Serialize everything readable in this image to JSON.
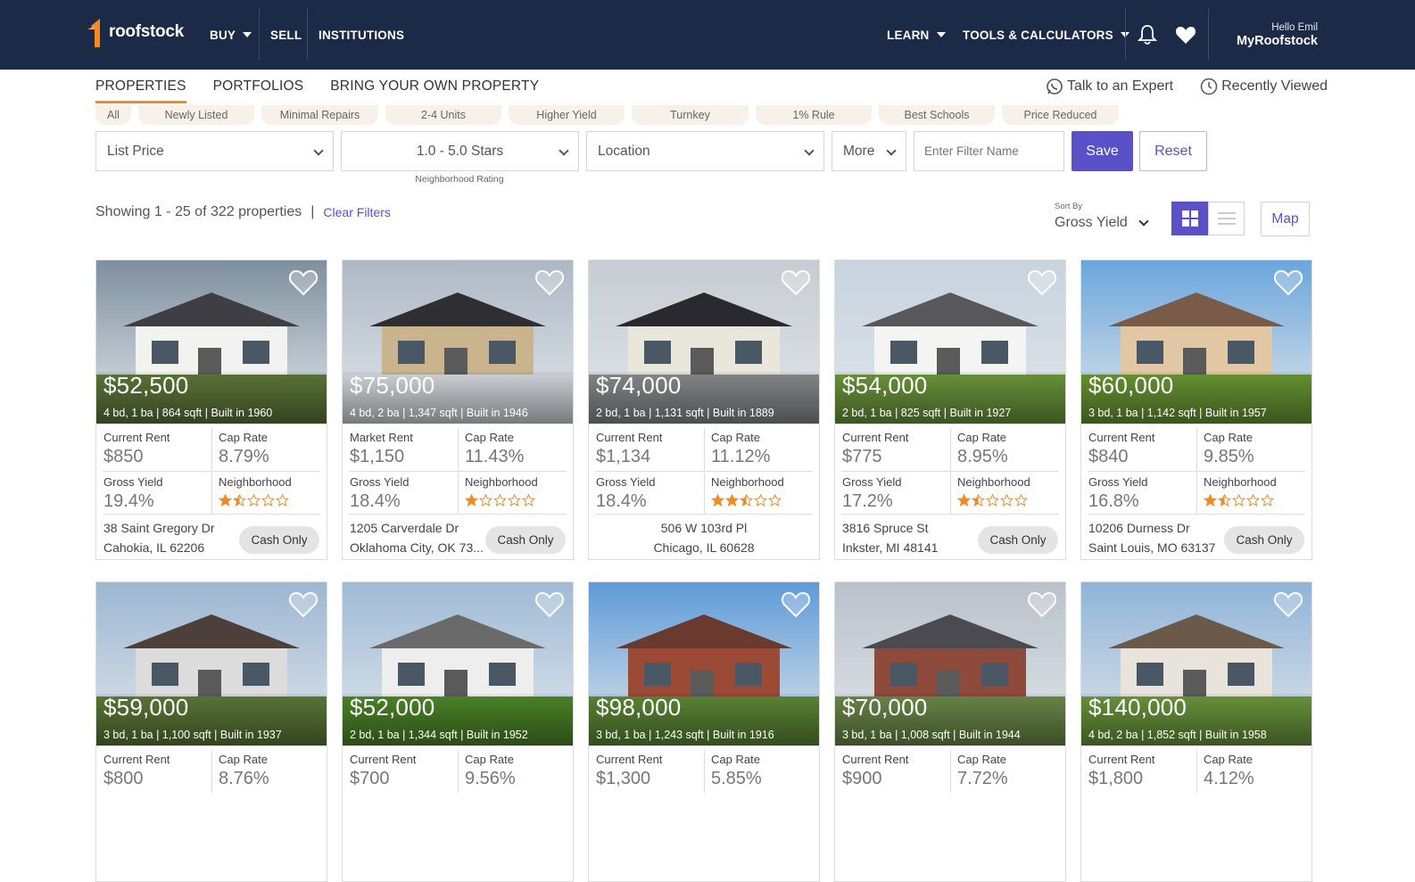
{
  "nav": {
    "logo_text": "roofstock",
    "buy": "BUY",
    "sell": "SELL",
    "institutions": "INSTITUTIONS",
    "learn": "LEARN",
    "tools": "TOOLS & CALCULATORS",
    "hello": "Hello Emil",
    "account": "MyRoofstock"
  },
  "tabs": {
    "properties": "PROPERTIES",
    "portfolios": "PORTFOLIOS",
    "byop": "BRING YOUR OWN PROPERTY",
    "talk": "Talk to an Expert",
    "recent": "Recently Viewed"
  },
  "chips": [
    "All",
    "Newly Listed",
    "Minimal Repairs",
    "2-4 Units",
    "Higher Yield",
    "Turnkey",
    "1% Rule",
    "Best Schools",
    "Price Reduced"
  ],
  "filters": {
    "price": "List Price",
    "stars": "1.0 - 5.0 Stars",
    "stars_caption": "Neighborhood Rating",
    "location": "Location",
    "more": "More",
    "name_placeholder": "Enter Filter Name",
    "save": "Save",
    "reset": "Reset"
  },
  "results": {
    "showing": "Showing 1 - 25 of 322 properties",
    "pipe": "|",
    "clear": "Clear Filters",
    "sort_label": "Sort By",
    "sort_value": "Gross Yield",
    "map": "Map"
  },
  "colors": {
    "nav_bg": "#1b2a47",
    "accent": "#5a50c8",
    "orange": "#f58a1f"
  },
  "cards": [
    {
      "price": "$52,500",
      "specs": "4 bd, 1 ba | 864 sqft | Built in 1960",
      "rent_label": "Current Rent",
      "rent": "$850",
      "cap_label": "Cap Rate",
      "cap": "8.79%",
      "gy_label": "Gross Yield",
      "gy": "19.4%",
      "nb_label": "Neighborhood",
      "rating": 1.5,
      "addr1": "38 Saint Gregory Dr",
      "addr2": "Cahokia, IL 62206",
      "badge": "Cash Only"
    },
    {
      "price": "$75,000",
      "specs": "4 bd, 2 ba | 1,347 sqft | Built in 1946",
      "rent_label": "Market Rent",
      "rent": "$1,150",
      "cap_label": "Cap Rate",
      "cap": "11.43%",
      "gy_label": "Gross Yield",
      "gy": "18.4%",
      "nb_label": "Neighborhood",
      "rating": 1,
      "addr1": "1205 Carverdale Dr",
      "addr2": "Oklahoma City, OK 73...",
      "badge": "Cash Only"
    },
    {
      "price": "$74,000",
      "specs": "2 bd, 1 ba | 1,131 sqft | Built in 1889",
      "rent_label": "Current Rent",
      "rent": "$1,134",
      "cap_label": "Cap Rate",
      "cap": "11.12%",
      "gy_label": "Gross Yield",
      "gy": "18.4%",
      "nb_label": "Neighborhood",
      "rating": 2.5,
      "addr1": "506 W 103rd Pl",
      "addr2": "Chicago, IL 60628",
      "badge": ""
    },
    {
      "price": "$54,000",
      "specs": "2 bd, 1 ba | 825 sqft | Built in 1927",
      "rent_label": "Current Rent",
      "rent": "$775",
      "cap_label": "Cap Rate",
      "cap": "8.95%",
      "gy_label": "Gross Yield",
      "gy": "17.2%",
      "nb_label": "Neighborhood",
      "rating": 1.5,
      "addr1": "3816 Spruce St",
      "addr2": "Inkster, MI 48141",
      "badge": "Cash Only"
    },
    {
      "price": "$60,000",
      "specs": "3 bd, 1 ba | 1,142 sqft | Built in 1957",
      "rent_label": "Current Rent",
      "rent": "$840",
      "cap_label": "Cap Rate",
      "cap": "9.85%",
      "gy_label": "Gross Yield",
      "gy": "16.8%",
      "nb_label": "Neighborhood",
      "rating": 1.5,
      "addr1": "10206 Durness Dr",
      "addr2": "Saint Louis, MO 63137",
      "badge": "Cash Only"
    },
    {
      "price": "$59,000",
      "specs": "3 bd, 1 ba | 1,100 sqft | Built in 1937",
      "rent_label": "Current Rent",
      "rent": "$800",
      "cap_label": "Cap Rate",
      "cap": "8.76%"
    },
    {
      "price": "$52,000",
      "specs": "2 bd, 1 ba | 1,344 sqft | Built in 1952",
      "rent_label": "Current Rent",
      "rent": "$700",
      "cap_label": "Cap Rate",
      "cap": "9.56%"
    },
    {
      "price": "$98,000",
      "specs": "3 bd, 1 ba | 1,243 sqft | Built in 1916",
      "rent_label": "Current Rent",
      "rent": "$1,300",
      "cap_label": "Cap Rate",
      "cap": "5.85%"
    },
    {
      "price": "$70,000",
      "specs": "3 bd, 1 ba | 1,008 sqft | Built in 1944",
      "rent_label": "Current Rent",
      "rent": "$900",
      "cap_label": "Cap Rate",
      "cap": "7.72%"
    },
    {
      "price": "$140,000",
      "specs": "4 bd, 2 ba | 1,852 sqft | Built in 1958",
      "rent_label": "Current Rent",
      "rent": "$1,800",
      "cap_label": "Cap Rate",
      "cap": "4.12%"
    }
  ]
}
